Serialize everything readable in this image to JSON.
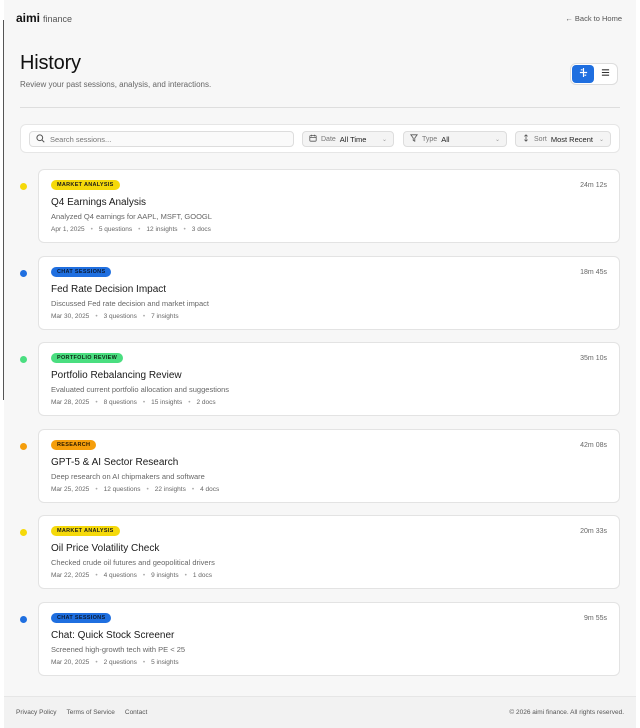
{
  "header": {
    "brand": "aimi",
    "brand_sub": "finance",
    "back_link": "← Back to Home"
  },
  "page": {
    "title": "History",
    "subtitle": "Review your past sessions, analysis, and interactions."
  },
  "view_toggle": {
    "options": [
      {
        "name": "timeline",
        "icon": "timeline-icon",
        "active": true
      },
      {
        "name": "list",
        "icon": "list-icon",
        "active": false
      }
    ]
  },
  "filters": {
    "search_placeholder": "Search sessions...",
    "search_value": "",
    "date": {
      "label": "Date",
      "value": "All Time"
    },
    "type": {
      "label": "Type",
      "value": "All"
    },
    "sort": {
      "label": "Sort",
      "value": "Most Recent"
    }
  },
  "categories": {
    "market_analysis": {
      "label": "MARKET ANALYSIS",
      "color": "#f5d90a",
      "text": "#1a1a1a"
    },
    "chat_sessions": {
      "label": "CHAT SESSIONS",
      "color": "#1f6fe0",
      "text": "#0b1a33"
    },
    "portfolio_review": {
      "label": "PORTFOLIO REVIEW",
      "color": "#4ade80",
      "text": "#0b2a14"
    },
    "research": {
      "label": "RESEARCH",
      "color": "#f59e0b",
      "text": "#2a1a00"
    }
  },
  "sessions": [
    {
      "badge": "MARKET ANALYSIS",
      "dot_color": "#f5d90a",
      "badge_color": "#f5d90a",
      "badge_text": "#1a1a1a",
      "duration": "24m 12s",
      "title": "Q4 Earnings Analysis",
      "description": "Analyzed Q4 earnings for AAPL, MSFT, GOOGL",
      "date": "Apr 1, 2025",
      "meta": [
        "5 questions",
        "12 insights",
        "3 docs"
      ]
    },
    {
      "badge": "CHAT SESSIONS",
      "dot_color": "#1f6fe0",
      "badge_color": "#1f6fe0",
      "badge_text": "#0b1a33",
      "duration": "18m 45s",
      "title": "Fed Rate Decision Impact",
      "description": "Discussed Fed rate decision and market impact",
      "date": "Mar 30, 2025",
      "meta": [
        "3 questions",
        "7 insights"
      ]
    },
    {
      "badge": "PORTFOLIO REVIEW",
      "dot_color": "#4ade80",
      "badge_color": "#4ade80",
      "badge_text": "#0b2a14",
      "duration": "35m 10s",
      "title": "Portfolio Rebalancing Review",
      "description": "Evaluated current portfolio allocation and suggestions",
      "date": "Mar 28, 2025",
      "meta": [
        "8 questions",
        "15 insights",
        "2 docs"
      ]
    },
    {
      "badge": "RESEARCH",
      "dot_color": "#f59e0b",
      "badge_color": "#f59e0b",
      "badge_text": "#2a1a00",
      "duration": "42m 08s",
      "title": "GPT-5 & AI Sector Research",
      "description": "Deep research on AI chipmakers and software",
      "date": "Mar 25, 2025",
      "meta": [
        "12 questions",
        "22 insights",
        "4 docs"
      ]
    },
    {
      "badge": "MARKET ANALYSIS",
      "dot_color": "#f5d90a",
      "badge_color": "#f5d90a",
      "badge_text": "#1a1a1a",
      "duration": "20m 33s",
      "title": "Oil Price Volatility Check",
      "description": "Checked crude oil futures and geopolitical drivers",
      "date": "Mar 22, 2025",
      "meta": [
        "4 questions",
        "9 insights",
        "1 docs"
      ]
    },
    {
      "badge": "CHAT SESSIONS",
      "dot_color": "#1f6fe0",
      "badge_color": "#1f6fe0",
      "badge_text": "#0b1a33",
      "duration": "9m 55s",
      "title": "Chat: Quick Stock Screener",
      "description": "Screened high-growth tech with PE < 25",
      "date": "Mar 20, 2025",
      "meta": [
        "2 questions",
        "5 insights"
      ]
    }
  ],
  "footer": {
    "links": [
      "Privacy Policy",
      "Terms of Service",
      "Contact"
    ],
    "copyright": "© 2026 aimi finance. All rights reserved."
  }
}
